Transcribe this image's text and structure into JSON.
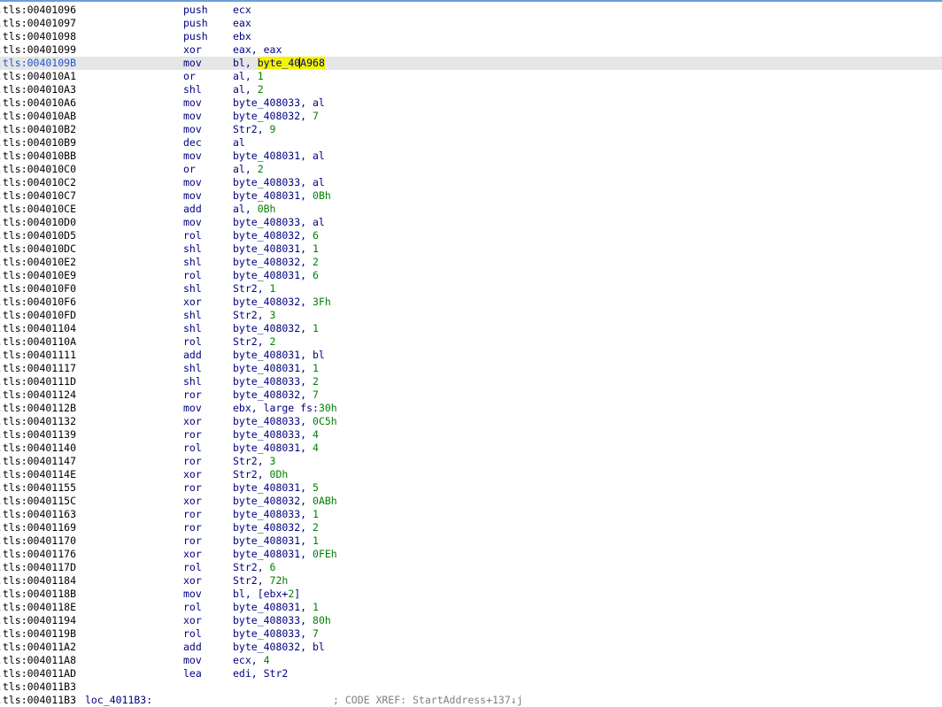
{
  "lines": [
    {
      "addr": ".tls:00401096",
      "mn": "push",
      "ops": [
        {
          "t": "ecx"
        }
      ]
    },
    {
      "addr": ".tls:00401097",
      "mn": "push",
      "ops": [
        {
          "t": "eax"
        }
      ]
    },
    {
      "addr": ".tls:00401098",
      "mn": "push",
      "ops": [
        {
          "t": "ebx"
        }
      ]
    },
    {
      "addr": ".tls:00401099",
      "mn": "xor",
      "ops": [
        {
          "t": "eax, eax"
        }
      ]
    },
    {
      "addr": ".tls:0040109B",
      "mn": "mov",
      "current": true,
      "ops": [
        {
          "t": "bl, "
        },
        {
          "t": "byte_40",
          "c": "hl"
        },
        {
          "t": "",
          "c": "caret"
        },
        {
          "t": "A968",
          "c": "hl"
        }
      ]
    },
    {
      "addr": ".tls:004010A1",
      "mn": "or",
      "ops": [
        {
          "t": "al, "
        },
        {
          "t": "1",
          "c": "num"
        }
      ]
    },
    {
      "addr": ".tls:004010A3",
      "mn": "shl",
      "ops": [
        {
          "t": "al, "
        },
        {
          "t": "2",
          "c": "num"
        }
      ]
    },
    {
      "addr": ".tls:004010A6",
      "mn": "mov",
      "ops": [
        {
          "t": "byte_408033, al"
        }
      ]
    },
    {
      "addr": ".tls:004010AB",
      "mn": "mov",
      "ops": [
        {
          "t": "byte_408032, "
        },
        {
          "t": "7",
          "c": "num"
        }
      ]
    },
    {
      "addr": ".tls:004010B2",
      "mn": "mov",
      "ops": [
        {
          "t": "Str2, "
        },
        {
          "t": "9",
          "c": "num"
        }
      ]
    },
    {
      "addr": ".tls:004010B9",
      "mn": "dec",
      "ops": [
        {
          "t": "al"
        }
      ]
    },
    {
      "addr": ".tls:004010BB",
      "mn": "mov",
      "ops": [
        {
          "t": "byte_408031, al"
        }
      ]
    },
    {
      "addr": ".tls:004010C0",
      "mn": "or",
      "ops": [
        {
          "t": "al, "
        },
        {
          "t": "2",
          "c": "num"
        }
      ]
    },
    {
      "addr": ".tls:004010C2",
      "mn": "mov",
      "ops": [
        {
          "t": "byte_408033, al"
        }
      ]
    },
    {
      "addr": ".tls:004010C7",
      "mn": "mov",
      "ops": [
        {
          "t": "byte_408031, "
        },
        {
          "t": "0Bh",
          "c": "num"
        }
      ]
    },
    {
      "addr": ".tls:004010CE",
      "mn": "add",
      "ops": [
        {
          "t": "al, "
        },
        {
          "t": "0Bh",
          "c": "num"
        }
      ]
    },
    {
      "addr": ".tls:004010D0",
      "mn": "mov",
      "ops": [
        {
          "t": "byte_408033, al"
        }
      ]
    },
    {
      "addr": ".tls:004010D5",
      "mn": "rol",
      "ops": [
        {
          "t": "byte_408032, "
        },
        {
          "t": "6",
          "c": "num"
        }
      ]
    },
    {
      "addr": ".tls:004010DC",
      "mn": "shl",
      "ops": [
        {
          "t": "byte_408031, "
        },
        {
          "t": "1",
          "c": "num"
        }
      ]
    },
    {
      "addr": ".tls:004010E2",
      "mn": "shl",
      "ops": [
        {
          "t": "byte_408032, "
        },
        {
          "t": "2",
          "c": "num"
        }
      ]
    },
    {
      "addr": ".tls:004010E9",
      "mn": "rol",
      "ops": [
        {
          "t": "byte_408031, "
        },
        {
          "t": "6",
          "c": "num"
        }
      ]
    },
    {
      "addr": ".tls:004010F0",
      "mn": "shl",
      "ops": [
        {
          "t": "Str2, "
        },
        {
          "t": "1",
          "c": "num"
        }
      ]
    },
    {
      "addr": ".tls:004010F6",
      "mn": "xor",
      "ops": [
        {
          "t": "byte_408032, "
        },
        {
          "t": "3Fh",
          "c": "num"
        }
      ]
    },
    {
      "addr": ".tls:004010FD",
      "mn": "shl",
      "ops": [
        {
          "t": "Str2, "
        },
        {
          "t": "3",
          "c": "num"
        }
      ]
    },
    {
      "addr": ".tls:00401104",
      "mn": "shl",
      "ops": [
        {
          "t": "byte_408032, "
        },
        {
          "t": "1",
          "c": "num"
        }
      ]
    },
    {
      "addr": ".tls:0040110A",
      "mn": "rol",
      "ops": [
        {
          "t": "Str2, "
        },
        {
          "t": "2",
          "c": "num"
        }
      ]
    },
    {
      "addr": ".tls:00401111",
      "mn": "add",
      "ops": [
        {
          "t": "byte_408031, bl"
        }
      ]
    },
    {
      "addr": ".tls:00401117",
      "mn": "shl",
      "ops": [
        {
          "t": "byte_408031, "
        },
        {
          "t": "1",
          "c": "num"
        }
      ]
    },
    {
      "addr": ".tls:0040111D",
      "mn": "shl",
      "ops": [
        {
          "t": "byte_408033, "
        },
        {
          "t": "2",
          "c": "num"
        }
      ]
    },
    {
      "addr": ".tls:00401124",
      "mn": "ror",
      "ops": [
        {
          "t": "byte_408032, "
        },
        {
          "t": "7",
          "c": "num"
        }
      ]
    },
    {
      "addr": ".tls:0040112B",
      "mn": "mov",
      "ops": [
        {
          "t": "ebx, large fs:"
        },
        {
          "t": "30h",
          "c": "num"
        }
      ]
    },
    {
      "addr": ".tls:00401132",
      "mn": "xor",
      "ops": [
        {
          "t": "byte_408033, "
        },
        {
          "t": "0C5h",
          "c": "num"
        }
      ]
    },
    {
      "addr": ".tls:00401139",
      "mn": "ror",
      "ops": [
        {
          "t": "byte_408033, "
        },
        {
          "t": "4",
          "c": "num"
        }
      ]
    },
    {
      "addr": ".tls:00401140",
      "mn": "rol",
      "ops": [
        {
          "t": "byte_408031, "
        },
        {
          "t": "4",
          "c": "num"
        }
      ]
    },
    {
      "addr": ".tls:00401147",
      "mn": "ror",
      "ops": [
        {
          "t": "Str2, "
        },
        {
          "t": "3",
          "c": "num"
        }
      ]
    },
    {
      "addr": ".tls:0040114E",
      "mn": "xor",
      "ops": [
        {
          "t": "Str2, "
        },
        {
          "t": "0Dh",
          "c": "num"
        }
      ]
    },
    {
      "addr": ".tls:00401155",
      "mn": "ror",
      "ops": [
        {
          "t": "byte_408031, "
        },
        {
          "t": "5",
          "c": "num"
        }
      ]
    },
    {
      "addr": ".tls:0040115C",
      "mn": "xor",
      "ops": [
        {
          "t": "byte_408032, "
        },
        {
          "t": "0ABh",
          "c": "num"
        }
      ]
    },
    {
      "addr": ".tls:00401163",
      "mn": "ror",
      "ops": [
        {
          "t": "byte_408033, "
        },
        {
          "t": "1",
          "c": "num"
        }
      ]
    },
    {
      "addr": ".tls:00401169",
      "mn": "ror",
      "ops": [
        {
          "t": "byte_408032, "
        },
        {
          "t": "2",
          "c": "num"
        }
      ]
    },
    {
      "addr": ".tls:00401170",
      "mn": "ror",
      "ops": [
        {
          "t": "byte_408031, "
        },
        {
          "t": "1",
          "c": "num"
        }
      ]
    },
    {
      "addr": ".tls:00401176",
      "mn": "xor",
      "ops": [
        {
          "t": "byte_408031, "
        },
        {
          "t": "0FEh",
          "c": "num"
        }
      ]
    },
    {
      "addr": ".tls:0040117D",
      "mn": "rol",
      "ops": [
        {
          "t": "Str2, "
        },
        {
          "t": "6",
          "c": "num"
        }
      ]
    },
    {
      "addr": ".tls:00401184",
      "mn": "xor",
      "ops": [
        {
          "t": "Str2, "
        },
        {
          "t": "72h",
          "c": "num"
        }
      ]
    },
    {
      "addr": ".tls:0040118B",
      "mn": "mov",
      "ops": [
        {
          "t": "bl, [ebx+"
        },
        {
          "t": "2",
          "c": "num"
        },
        {
          "t": "]"
        }
      ]
    },
    {
      "addr": ".tls:0040118E",
      "mn": "rol",
      "ops": [
        {
          "t": "byte_408031, "
        },
        {
          "t": "1",
          "c": "num"
        }
      ]
    },
    {
      "addr": ".tls:00401194",
      "mn": "xor",
      "ops": [
        {
          "t": "byte_408033, "
        },
        {
          "t": "80h",
          "c": "num"
        }
      ]
    },
    {
      "addr": ".tls:0040119B",
      "mn": "rol",
      "ops": [
        {
          "t": "byte_408033, "
        },
        {
          "t": "7",
          "c": "num"
        }
      ]
    },
    {
      "addr": ".tls:004011A2",
      "mn": "add",
      "ops": [
        {
          "t": "byte_408032, bl"
        }
      ]
    },
    {
      "addr": ".tls:004011A8",
      "mn": "mov",
      "ops": [
        {
          "t": "ecx, "
        },
        {
          "t": "4",
          "c": "num"
        }
      ]
    },
    {
      "addr": ".tls:004011AD",
      "mn": "lea",
      "ops": [
        {
          "t": "edi, Str2"
        }
      ]
    },
    {
      "addr": ".tls:004011B3",
      "mn": "",
      "ops": []
    },
    {
      "addr": ".tls:004011B3",
      "label": "loc_4011B3:",
      "comment": "; CODE XREF: StartAddress+137↓j",
      "mn": "",
      "ops": []
    }
  ]
}
